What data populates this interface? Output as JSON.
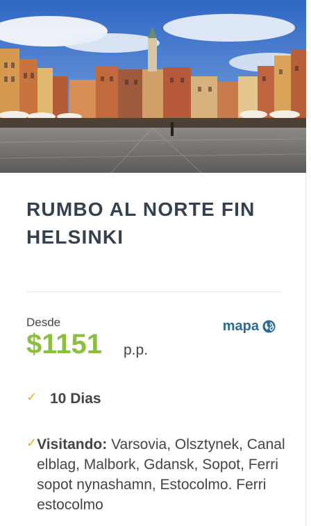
{
  "tour": {
    "title": "RUMBO AL NORTE FIN HELSINKI",
    "image_alt": "Plaza del casco antiguo de Varsovia"
  },
  "pricing": {
    "from_label": "Desde",
    "price": "$1151",
    "per_person": "p.p."
  },
  "map_link": {
    "label": "mapa",
    "icon": "globe-icon"
  },
  "features": {
    "duration": "10 Dias",
    "visiting_label": "Visitando:",
    "visiting_text": "Varsovia, Olsztynek, Canal elblag, Malbork, Gdansk, Sopot, Ferri sopot nynashamn, Estocolmo. Ferri estocolmo",
    "check_icon": "check-icon"
  },
  "colors": {
    "price": "#8cbf3f",
    "link": "#2b6a93",
    "check": "#e8b52b",
    "title": "#34414f"
  }
}
